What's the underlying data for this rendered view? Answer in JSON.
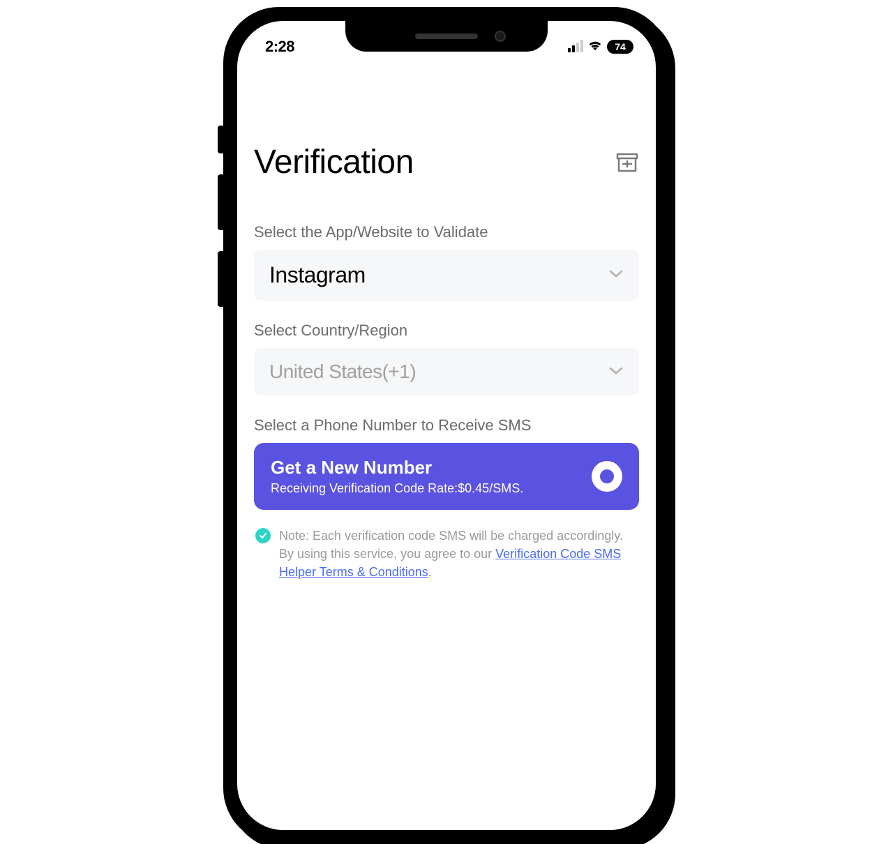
{
  "status_bar": {
    "time": "2:28",
    "battery": "74"
  },
  "header": {
    "title": "Verification"
  },
  "app_section": {
    "label": "Select the App/Website to Validate",
    "value": "Instagram"
  },
  "region_section": {
    "label": "Select Country/Region",
    "value": "United States(+1)"
  },
  "sms_section": {
    "label": "Select a Phone Number to Receive SMS",
    "cta_title": "Get a New Number",
    "cta_sub": "Receiving Verification Code Rate:$0.45/SMS."
  },
  "note": {
    "text_prefix": "Note: Each verification code SMS will be charged accordingly. By using this service, you agree to our ",
    "link_text": "Verification Code SMS Helper Terms & Conditions",
    "text_suffix": "."
  }
}
